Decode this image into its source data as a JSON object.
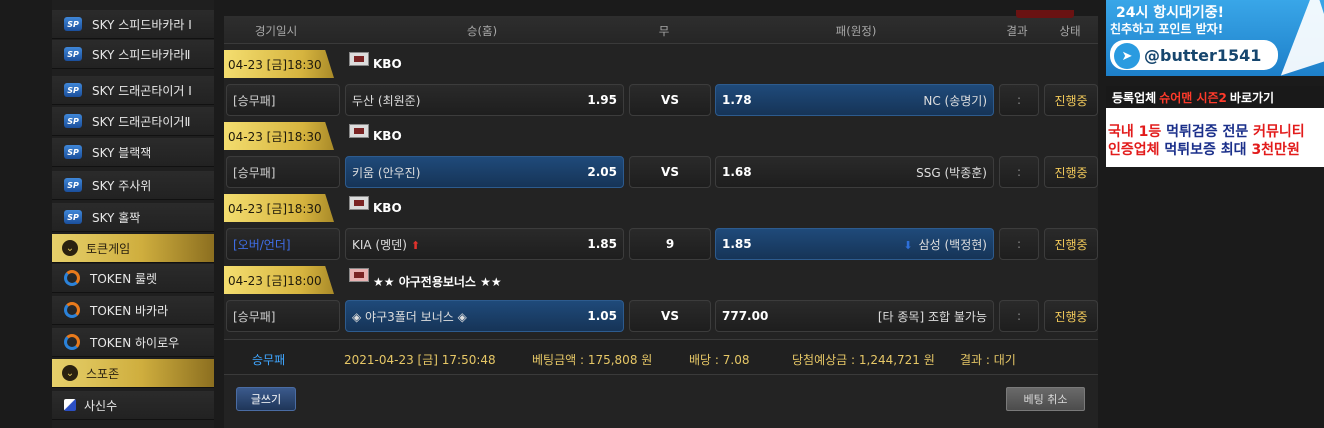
{
  "sidebar": {
    "items": [
      {
        "label": "SKY 스피드바카라 I",
        "icon": "sp-icon",
        "type": "game"
      },
      {
        "label": "SKY 스피드바카라Ⅱ",
        "icon": "sp-icon",
        "type": "game"
      },
      {
        "label": "SKY 드래곤타이거 I",
        "icon": "sp-icon",
        "type": "game"
      },
      {
        "label": "SKY 드래곤타이거Ⅱ",
        "icon": "sp-icon",
        "type": "game"
      },
      {
        "label": "SKY 블랙잭",
        "icon": "sp-icon",
        "type": "game"
      },
      {
        "label": "SKY 주사위",
        "icon": "sp-icon",
        "type": "game"
      },
      {
        "label": "SKY 홀짝",
        "icon": "sp-icon",
        "type": "game"
      },
      {
        "label": "토큰게임",
        "icon": "chevron-down-icon",
        "type": "section"
      },
      {
        "label": "TOKEN 룰렛",
        "icon": "token-icon",
        "type": "game"
      },
      {
        "label": "TOKEN 바카라",
        "icon": "token-icon",
        "type": "game"
      },
      {
        "label": "TOKEN 하이로우",
        "icon": "token-icon",
        "type": "game"
      },
      {
        "label": "스포존",
        "icon": "chevron-down-icon",
        "type": "section"
      },
      {
        "label": "사신수",
        "icon": "square-icon",
        "type": "game"
      }
    ],
    "sp_badge": "SP"
  },
  "table": {
    "headers": {
      "date": "경기일시",
      "home": "승(홈)",
      "draw": "무",
      "away": "패(원정)",
      "result": "결과",
      "status": "상태"
    }
  },
  "games": [
    {
      "datetime": "04-23 [금]18:30",
      "league": "KBO",
      "bet_type": "[승무패]",
      "home": "두산 (최원준)",
      "home_odds": "1.95",
      "draw": "VS",
      "away_odds": "1.78",
      "away": "NC (송명기)",
      "result": ":",
      "status": "진행중",
      "selected": "away"
    },
    {
      "datetime": "04-23 [금]18:30",
      "league": "KBO",
      "bet_type": "[승무패]",
      "home": "키움 (안우진)",
      "home_odds": "2.05",
      "draw": "VS",
      "away_odds": "1.68",
      "away": "SSG (박종훈)",
      "result": ":",
      "status": "진행중",
      "selected": "home"
    },
    {
      "datetime": "04-23 [금]18:30",
      "league": "KBO",
      "bet_type": "[오버/언더]",
      "home": "KIA (멩덴)",
      "home_odds": "1.85",
      "draw": "9",
      "away_odds": "1.85",
      "away": "삼성 (백정현)",
      "result": ":",
      "status": "진행중",
      "selected": "away"
    },
    {
      "datetime": "04-23 [금]18:00",
      "league": "★★ 야구전용보너스 ★★",
      "bet_type": "[승무패]",
      "home": "◈ 야구3폴더 보너스 ◈",
      "home_odds": "1.05",
      "draw": "VS",
      "away_odds": "777.00",
      "away": "[타 종목] 조합 불가능",
      "result": ":",
      "status": "진행중",
      "selected": "home"
    }
  ],
  "summary": {
    "type": "승무패",
    "datetime": "2021-04-23 [금] 17:50:48",
    "bet_amount": "베팅금액 : 175,808 원",
    "odds": "배당 : 7.08",
    "expected": "당첨예상금 : 1,244,721 원",
    "result": "결과 : 대기"
  },
  "buttons": {
    "write": "글쓰기",
    "cancel": "베팅 취소"
  },
  "banner_telegram": {
    "line1": "24시 항시대기중!",
    "line2": "친추하고 포인트 받자!",
    "handle": "@butter1541"
  },
  "banner_ad": {
    "top_prefix": "등록업체",
    "top_highlight": "슈어맨 시즌2",
    "top_suffix": "바로가기",
    "l2_a": "국내 1등 ",
    "l2_b": "먹튀검증 전문 ",
    "l2_c": "커뮤니티",
    "l3_a": "인증업체 ",
    "l3_b": "먹튀보증 최대 ",
    "l3_c": "3천만원"
  },
  "colors": {
    "gold": "#d6b43f",
    "selected_blue": "#1f4a7a",
    "status_yellow": "#f0c85a",
    "summary_blue": "#3fa6ff"
  }
}
